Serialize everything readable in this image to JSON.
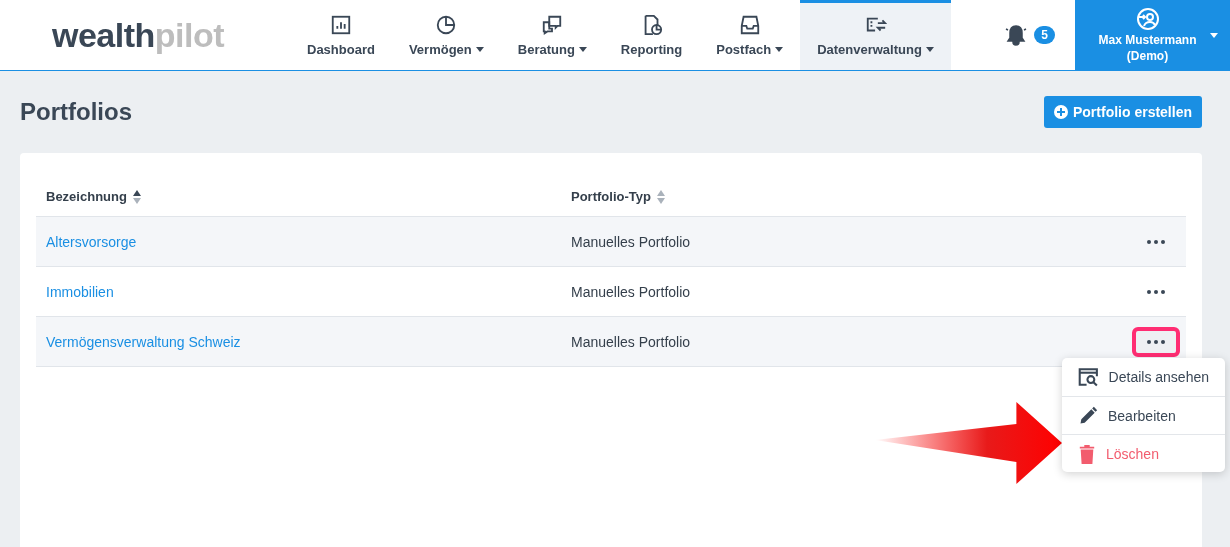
{
  "logo": {
    "part_1": "wealth",
    "part_2": "pilot"
  },
  "nav": [
    {
      "label": "Dashboard",
      "dropdown": false,
      "selected": false
    },
    {
      "label": "Vermögen",
      "dropdown": true,
      "selected": false
    },
    {
      "label": "Beratung",
      "dropdown": true,
      "selected": false
    },
    {
      "label": "Reporting",
      "dropdown": false,
      "selected": false
    },
    {
      "label": "Postfach",
      "dropdown": true,
      "selected": false
    },
    {
      "label": "Datenverwaltung",
      "dropdown": true,
      "selected": true
    }
  ],
  "notifications": {
    "count": "5"
  },
  "user": {
    "name": "Max Mustermann",
    "note": "(Demo)"
  },
  "page": {
    "title": "Portfolios",
    "create_button": "Portfolio erstellen"
  },
  "table": {
    "columns": [
      {
        "label": "Bezeichnung",
        "sorted": true
      },
      {
        "label": "Portfolio-Typ",
        "sorted": false
      }
    ],
    "rows": [
      {
        "name": "Altersvorsorge",
        "type": "Manuelles Portfolio",
        "highlighted": false
      },
      {
        "name": "Immobilien",
        "type": "Manuelles Portfolio",
        "highlighted": false
      },
      {
        "name": "Vermögensverwaltung Schweiz",
        "type": "Manuelles Portfolio",
        "highlighted": true
      }
    ]
  },
  "row_menu": [
    {
      "label": "Details ansehen",
      "kind": "view"
    },
    {
      "label": "Bearbeiten",
      "kind": "edit"
    },
    {
      "label": "Löschen",
      "kind": "delete"
    }
  ]
}
